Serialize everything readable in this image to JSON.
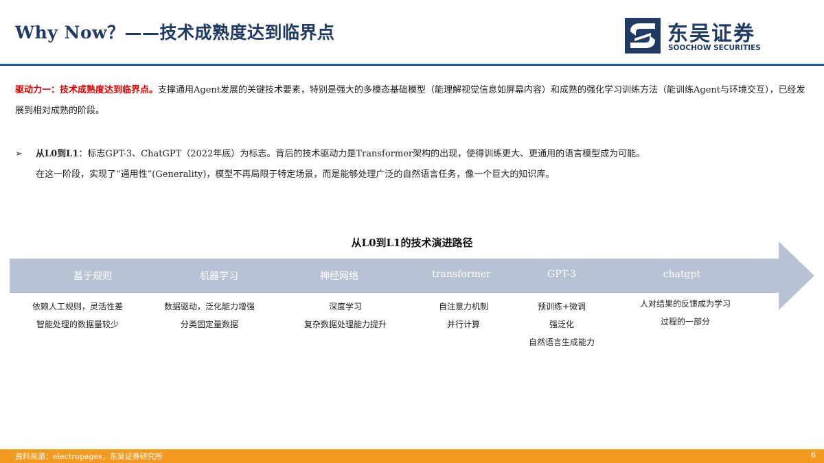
{
  "header": {
    "title": "Why Now？——技术成熟度达到临界点",
    "logo_cn": "东吴证券",
    "logo_en": "SOOCHOW SECURITIES"
  },
  "intro": {
    "lead": "驱动力一：技术成熟度达到临界点。",
    "text": "支撑通用Agent发展的关键技术要素，特别是强大的多模态基础模型（能理解视觉信息如屏幕内容）和成熟的强化学习训练方法（能训练Agent与环境交互），已经发展到相对成熟的阶段。"
  },
  "bullet": {
    "label": "从L0到L1",
    "line1": "：标志GPT-3、ChatGPT（2022年底）为标志。背后的技术驱动力是Transformer架构的出现，使得训练更大、更通用的语言模型成为可能。",
    "line2": "在这一阶段，实现了“通用性”(Generality)，模型不再局限于特定场景，而是能够处理广泛的自然语言任务，像一个巨大的知识库。"
  },
  "diagram": {
    "title": "从L0到L1的技术演进路径",
    "colors": {
      "arrow": "#b7c3d4",
      "stage_text": "#ffffff"
    },
    "stages": [
      {
        "label": "基于规则",
        "desc": [
          "依赖人工规则，灵活性差",
          "智能处理的数据量较少"
        ]
      },
      {
        "label": "机器学习",
        "desc": [
          "数据驱动，泛化能力增强",
          "分类固定量数据"
        ]
      },
      {
        "label": "神经网络",
        "desc": [
          "深度学习",
          "复杂数据处理能力提升"
        ]
      },
      {
        "label": "transformer",
        "desc": [
          "自注意力机制",
          "并行计算"
        ]
      },
      {
        "label": "GPT-3",
        "desc": [
          "预训练+微调",
          "强泛化",
          "自然语言生成能力"
        ]
      },
      {
        "label": "chatgpt",
        "desc": [
          "人对结果的反馈成为学习",
          "过程的一部分"
        ]
      }
    ]
  },
  "footer": {
    "source": "资料来源：electropages，东吴证券研究所",
    "page": "6",
    "color": "#f39b21"
  }
}
